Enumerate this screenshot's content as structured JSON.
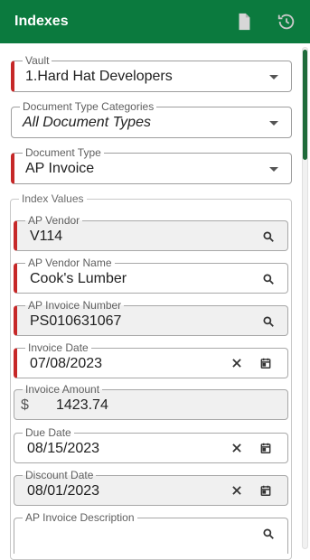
{
  "header": {
    "title": "Indexes",
    "icons": [
      "document-icon",
      "history-icon"
    ],
    "bg_color": "#0b7a3e"
  },
  "fields": {
    "vault": {
      "label": "Vault",
      "value": "1.Hard Hat Developers"
    },
    "doc_type_categories": {
      "label": "Document Type Categories",
      "value": "All Document Types"
    },
    "doc_type": {
      "label": "Document Type",
      "value": "AP Invoice"
    }
  },
  "index_values": {
    "label": "Index Values",
    "items": {
      "ap_vendor": {
        "label": "AP Vendor",
        "value": "V114"
      },
      "ap_vendor_name": {
        "label": "AP Vendor Name",
        "value": "Cook's Lumber"
      },
      "ap_invoice_number": {
        "label": "AP Invoice Number",
        "value": "PS010631067"
      },
      "invoice_date": {
        "label": "Invoice Date",
        "value": "07/08/2023"
      },
      "invoice_amount": {
        "label": "Invoice Amount",
        "currency": "$",
        "value": "1423.74"
      },
      "due_date": {
        "label": "Due Date",
        "value": "08/15/2023"
      },
      "discount_date": {
        "label": "Discount Date",
        "value": "08/01/2023"
      },
      "ap_invoice_description": {
        "label": "AP Invoice Description",
        "value": ""
      }
    }
  },
  "colors": {
    "required_marker": "#c62828",
    "accent_green": "#0b7a3e"
  }
}
